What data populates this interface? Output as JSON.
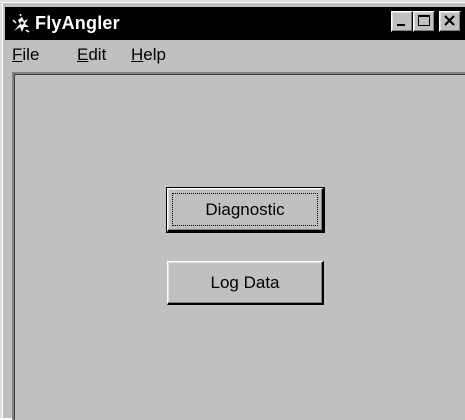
{
  "window": {
    "title": "FlyAngler",
    "app_icon": "fly-angler-icon",
    "controls": {
      "minimize_icon": "minimize-icon",
      "maximize_icon": "maximize-icon",
      "close_icon": "close-icon"
    }
  },
  "menubar": {
    "items": [
      {
        "label_mnemonic": "F",
        "label_rest": "ile"
      },
      {
        "label_mnemonic": "E",
        "label_rest": "dit"
      },
      {
        "label_mnemonic": "H",
        "label_rest": "elp"
      }
    ]
  },
  "main": {
    "buttons": [
      {
        "label": "Diagnostic",
        "focused": true
      },
      {
        "label": "Log Data",
        "focused": false
      }
    ]
  },
  "colors": {
    "title_bar": "#000000",
    "face": "#c0c0c0",
    "highlight": "#ffffff",
    "shadow": "#808080",
    "dark_shadow": "#000000"
  }
}
